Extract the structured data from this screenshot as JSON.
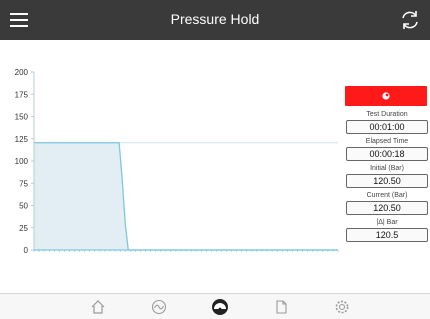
{
  "header": {
    "title": "Pressure Hold",
    "menu_icon": "hamburger-menu-icon",
    "refresh_icon": "refresh-icon"
  },
  "chart_data": {
    "type": "area",
    "title": "",
    "xlabel": "",
    "ylabel": "",
    "ylim": [
      0,
      200
    ],
    "yticks": [
      0,
      25,
      50,
      75,
      100,
      125,
      150,
      175,
      200
    ],
    "reference_line": 120.5,
    "series": [
      {
        "x": [
          0,
          56,
          58,
          60,
          62,
          200
        ],
        "values": [
          120.5,
          120.5,
          80,
          30,
          0,
          0
        ]
      }
    ],
    "xlim": [
      0,
      200
    ],
    "colors": {
      "fill": "#e3eef4",
      "line": "#7ec7dc",
      "ref": "#cfe3ea",
      "axis": "#b8cdd6"
    }
  },
  "panel": {
    "record_icon": "record-icon",
    "record_color": "#ff1a1a",
    "fields": [
      {
        "label": "Test Duration",
        "value": "00:01:00"
      },
      {
        "label": "Elapsed Time",
        "value": "00:00:18"
      },
      {
        "label": "Initial (Bar)",
        "value": "120.50"
      },
      {
        "label": "Current (Bar)",
        "value": "120.50"
      },
      {
        "label": "|Δ| Bar",
        "value": "120.5"
      }
    ]
  },
  "tabbar": {
    "tabs": [
      {
        "name": "home-icon"
      },
      {
        "name": "graph-icon"
      },
      {
        "name": "gauge-icon"
      },
      {
        "name": "document-icon"
      },
      {
        "name": "settings-icon"
      }
    ],
    "active_index": 2
  }
}
